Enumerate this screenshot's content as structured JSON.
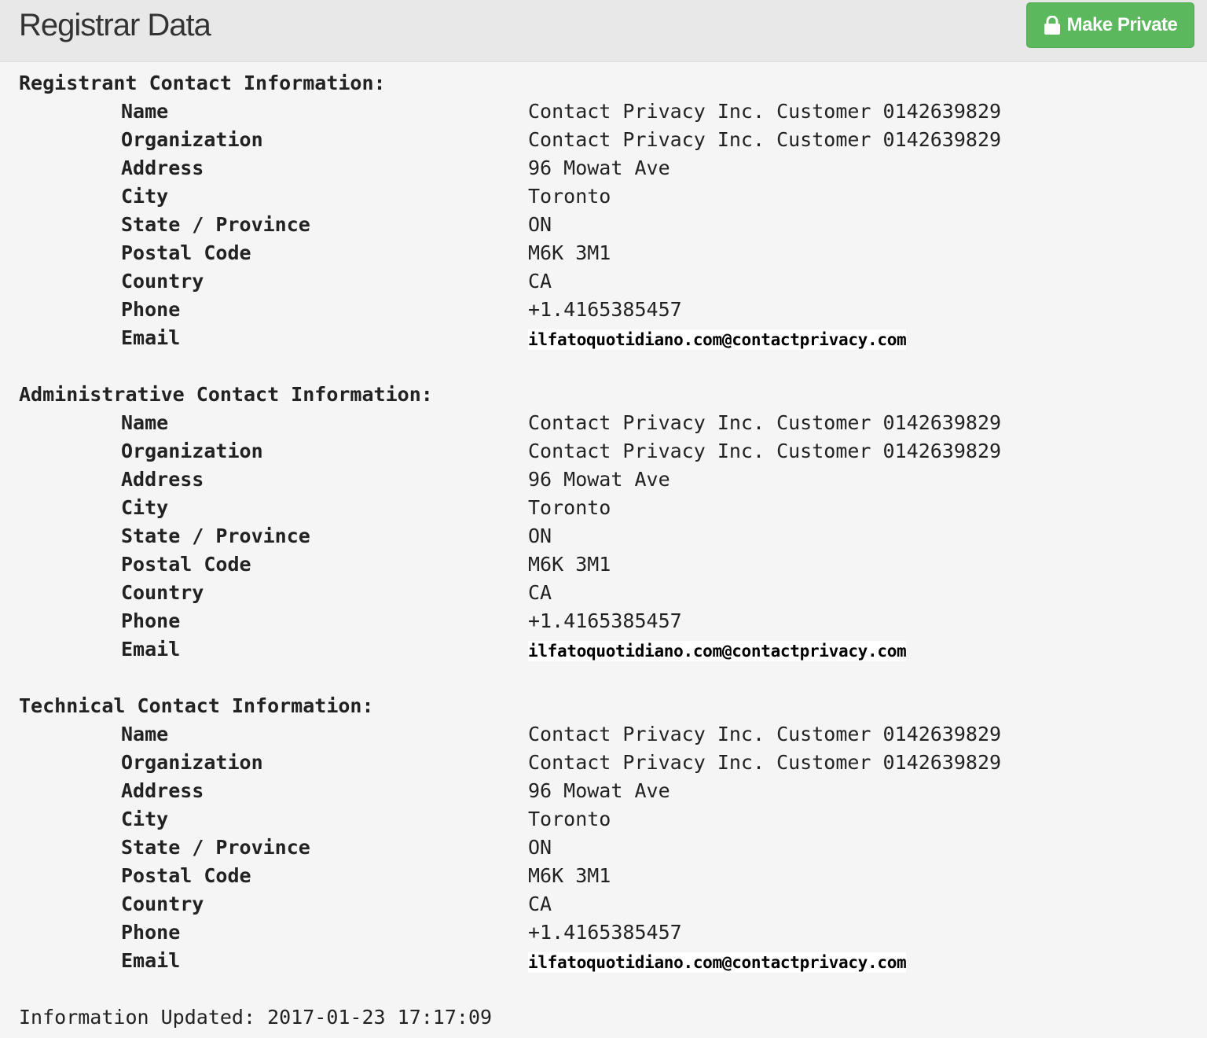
{
  "header": {
    "title": "Registrar Data",
    "make_private_label": "Make Private"
  },
  "sections": [
    {
      "title": "Registrant Contact Information:",
      "fields": [
        {
          "label": "Name",
          "value": "Contact Privacy Inc. Customer 0142639829"
        },
        {
          "label": "Organization",
          "value": "Contact Privacy Inc. Customer 0142639829"
        },
        {
          "label": "Address",
          "value": "96 Mowat Ave"
        },
        {
          "label": "City",
          "value": "Toronto"
        },
        {
          "label": "State / Province",
          "value": "ON"
        },
        {
          "label": "Postal Code",
          "value": "M6K 3M1"
        },
        {
          "label": "Country",
          "value": "CA"
        },
        {
          "label": "Phone",
          "value": "+1.4165385457"
        },
        {
          "label": "Email",
          "value": "ilfatoquotidiano.com@contactprivacy.com"
        }
      ]
    },
    {
      "title": "Administrative Contact Information:",
      "fields": [
        {
          "label": "Name",
          "value": "Contact Privacy Inc. Customer 0142639829"
        },
        {
          "label": "Organization",
          "value": "Contact Privacy Inc. Customer 0142639829"
        },
        {
          "label": "Address",
          "value": "96 Mowat Ave"
        },
        {
          "label": "City",
          "value": "Toronto"
        },
        {
          "label": "State / Province",
          "value": "ON"
        },
        {
          "label": "Postal Code",
          "value": "M6K 3M1"
        },
        {
          "label": "Country",
          "value": "CA"
        },
        {
          "label": "Phone",
          "value": "+1.4165385457"
        },
        {
          "label": "Email",
          "value": "ilfatoquotidiano.com@contactprivacy.com"
        }
      ]
    },
    {
      "title": "Technical Contact Information:",
      "fields": [
        {
          "label": "Name",
          "value": "Contact Privacy Inc. Customer 0142639829"
        },
        {
          "label": "Organization",
          "value": "Contact Privacy Inc. Customer 0142639829"
        },
        {
          "label": "Address",
          "value": "96 Mowat Ave"
        },
        {
          "label": "City",
          "value": "Toronto"
        },
        {
          "label": "State / Province",
          "value": "ON"
        },
        {
          "label": "Postal Code",
          "value": "M6K 3M1"
        },
        {
          "label": "Country",
          "value": "CA"
        },
        {
          "label": "Phone",
          "value": "+1.4165385457"
        },
        {
          "label": "Email",
          "value": "ilfatoquotidiano.com@contactprivacy.com"
        }
      ]
    }
  ],
  "footer": {
    "updated_text": "Information Updated: 2017-01-23 17:17:09"
  },
  "colors": {
    "button_green": "#5cb85c",
    "header_bg": "#e8e8e8",
    "page_bg": "#f5f5f5"
  },
  "icons": {
    "make_private": "lock-icon"
  }
}
